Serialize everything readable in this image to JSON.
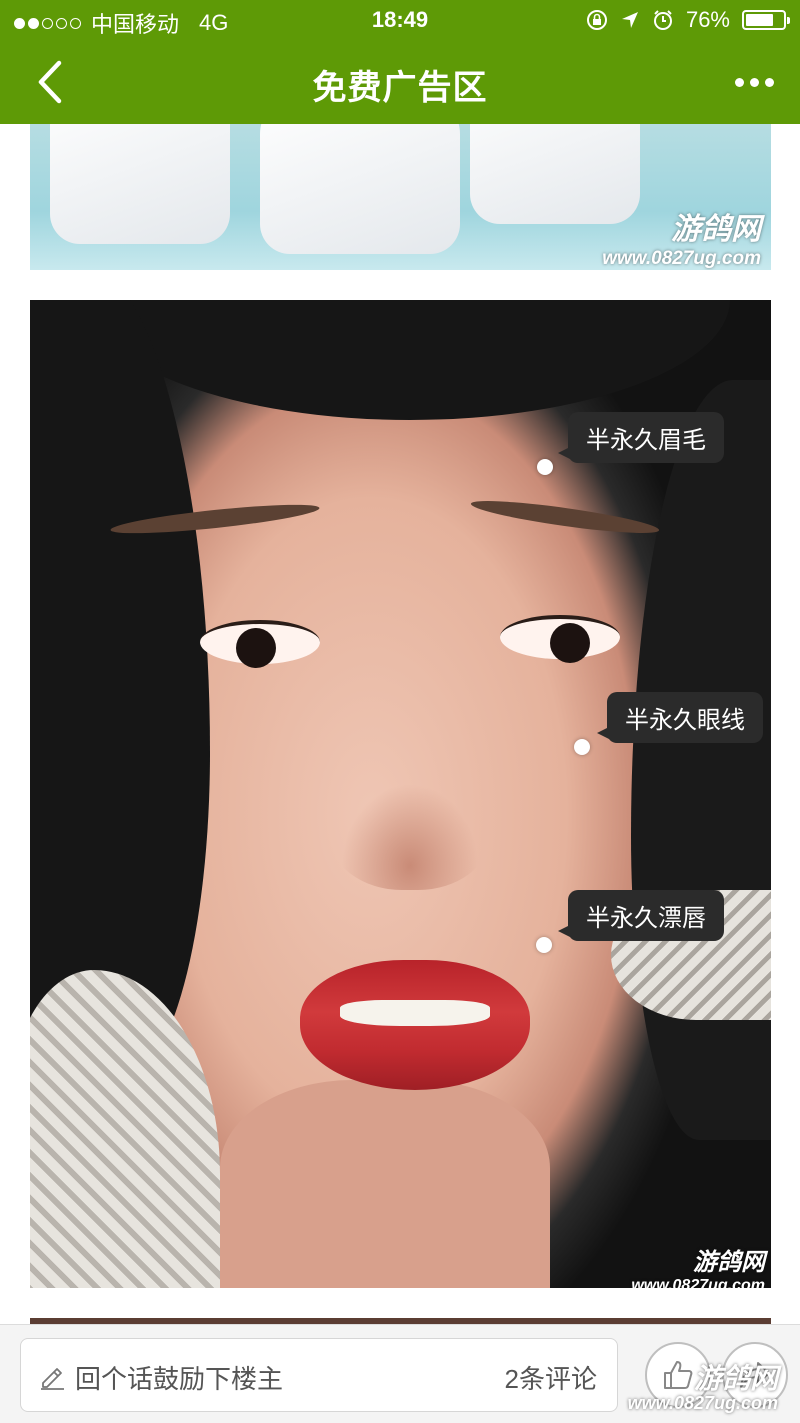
{
  "status_bar": {
    "signal_dots_filled": 2,
    "signal_dots_total": 5,
    "carrier": "中国移动",
    "network": "4G",
    "time": "18:49",
    "battery_percent": "76%",
    "battery_level": 0.76,
    "icons": [
      "orientation-lock-icon",
      "location-arrow-icon",
      "alarm-icon",
      "battery-icon"
    ]
  },
  "nav": {
    "title": "免费广告区",
    "back_icon": "chevron-left-icon",
    "more_icon": "more-dots-icon"
  },
  "content": {
    "image1": {
      "watermark_brand": "游鸽网",
      "watermark_url": "www.0827ug.com"
    },
    "image2": {
      "labels": [
        "半永久眉毛",
        "半永久眼线",
        "半永久漂唇"
      ],
      "watermark_brand": "游鸽网",
      "watermark_url": "www.0827ug.com"
    }
  },
  "bottom_bar": {
    "comment_placeholder": "回个话鼓励下楼主",
    "comment_count": "2条评论",
    "corner_watermark_brand": "游鸽网",
    "corner_watermark_url": "www.0827ug.com"
  },
  "colors": {
    "brand_green": "#5e9a06",
    "bubble_bg": "#2b2b2b"
  }
}
